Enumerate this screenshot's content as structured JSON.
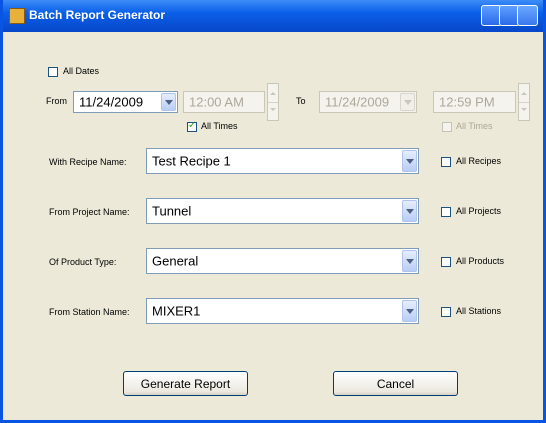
{
  "window": {
    "title": "Batch Report Generator"
  },
  "all_dates": {
    "label": "All Dates",
    "checked": false
  },
  "from": {
    "label": "From",
    "date": "11/24/2009",
    "time": "12:00 AM",
    "all_times": {
      "label": "All Times",
      "checked": true
    }
  },
  "to": {
    "label": "To",
    "date": "11/24/2009",
    "time": "12:59 PM",
    "all_times": {
      "label": "All Times",
      "checked": false
    }
  },
  "recipe": {
    "label": "With Recipe Name:",
    "value": "Test Recipe 1",
    "all_label": "All Recipes"
  },
  "project": {
    "label": "From Project Name:",
    "value": "Tunnel",
    "all_label": "All Projects"
  },
  "product": {
    "label": "Of Product Type:",
    "value": "General",
    "all_label": "All Products"
  },
  "station": {
    "label": "From Station Name:",
    "value": "MIXER1",
    "all_label": "All Stations"
  },
  "buttons": {
    "generate": "Generate Report",
    "cancel": "Cancel"
  },
  "colors": {
    "titlebar": "#0a5fe8",
    "background": "#ece9d8",
    "field_border": "#7f9db9"
  }
}
